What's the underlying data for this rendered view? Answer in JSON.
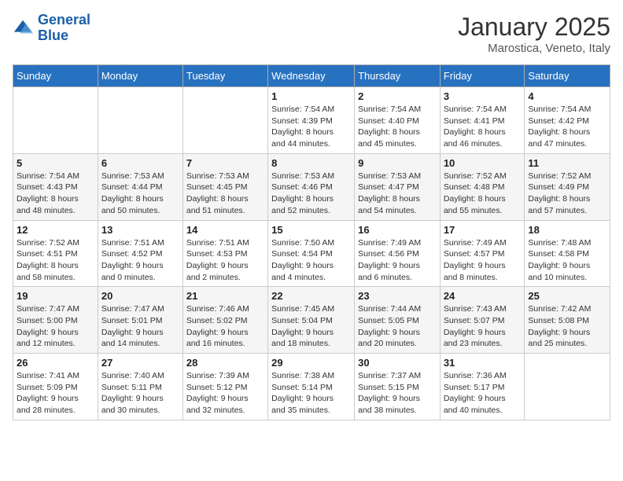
{
  "logo": {
    "line1": "General",
    "line2": "Blue"
  },
  "title": "January 2025",
  "subtitle": "Marostica, Veneto, Italy",
  "weekdays": [
    "Sunday",
    "Monday",
    "Tuesday",
    "Wednesday",
    "Thursday",
    "Friday",
    "Saturday"
  ],
  "weeks": [
    [
      {
        "day": "",
        "info": ""
      },
      {
        "day": "",
        "info": ""
      },
      {
        "day": "",
        "info": ""
      },
      {
        "day": "1",
        "info": "Sunrise: 7:54 AM\nSunset: 4:39 PM\nDaylight: 8 hours\nand 44 minutes."
      },
      {
        "day": "2",
        "info": "Sunrise: 7:54 AM\nSunset: 4:40 PM\nDaylight: 8 hours\nand 45 minutes."
      },
      {
        "day": "3",
        "info": "Sunrise: 7:54 AM\nSunset: 4:41 PM\nDaylight: 8 hours\nand 46 minutes."
      },
      {
        "day": "4",
        "info": "Sunrise: 7:54 AM\nSunset: 4:42 PM\nDaylight: 8 hours\nand 47 minutes."
      }
    ],
    [
      {
        "day": "5",
        "info": "Sunrise: 7:54 AM\nSunset: 4:43 PM\nDaylight: 8 hours\nand 48 minutes."
      },
      {
        "day": "6",
        "info": "Sunrise: 7:53 AM\nSunset: 4:44 PM\nDaylight: 8 hours\nand 50 minutes."
      },
      {
        "day": "7",
        "info": "Sunrise: 7:53 AM\nSunset: 4:45 PM\nDaylight: 8 hours\nand 51 minutes."
      },
      {
        "day": "8",
        "info": "Sunrise: 7:53 AM\nSunset: 4:46 PM\nDaylight: 8 hours\nand 52 minutes."
      },
      {
        "day": "9",
        "info": "Sunrise: 7:53 AM\nSunset: 4:47 PM\nDaylight: 8 hours\nand 54 minutes."
      },
      {
        "day": "10",
        "info": "Sunrise: 7:52 AM\nSunset: 4:48 PM\nDaylight: 8 hours\nand 55 minutes."
      },
      {
        "day": "11",
        "info": "Sunrise: 7:52 AM\nSunset: 4:49 PM\nDaylight: 8 hours\nand 57 minutes."
      }
    ],
    [
      {
        "day": "12",
        "info": "Sunrise: 7:52 AM\nSunset: 4:51 PM\nDaylight: 8 hours\nand 58 minutes."
      },
      {
        "day": "13",
        "info": "Sunrise: 7:51 AM\nSunset: 4:52 PM\nDaylight: 9 hours\nand 0 minutes."
      },
      {
        "day": "14",
        "info": "Sunrise: 7:51 AM\nSunset: 4:53 PM\nDaylight: 9 hours\nand 2 minutes."
      },
      {
        "day": "15",
        "info": "Sunrise: 7:50 AM\nSunset: 4:54 PM\nDaylight: 9 hours\nand 4 minutes."
      },
      {
        "day": "16",
        "info": "Sunrise: 7:49 AM\nSunset: 4:56 PM\nDaylight: 9 hours\nand 6 minutes."
      },
      {
        "day": "17",
        "info": "Sunrise: 7:49 AM\nSunset: 4:57 PM\nDaylight: 9 hours\nand 8 minutes."
      },
      {
        "day": "18",
        "info": "Sunrise: 7:48 AM\nSunset: 4:58 PM\nDaylight: 9 hours\nand 10 minutes."
      }
    ],
    [
      {
        "day": "19",
        "info": "Sunrise: 7:47 AM\nSunset: 5:00 PM\nDaylight: 9 hours\nand 12 minutes."
      },
      {
        "day": "20",
        "info": "Sunrise: 7:47 AM\nSunset: 5:01 PM\nDaylight: 9 hours\nand 14 minutes."
      },
      {
        "day": "21",
        "info": "Sunrise: 7:46 AM\nSunset: 5:02 PM\nDaylight: 9 hours\nand 16 minutes."
      },
      {
        "day": "22",
        "info": "Sunrise: 7:45 AM\nSunset: 5:04 PM\nDaylight: 9 hours\nand 18 minutes."
      },
      {
        "day": "23",
        "info": "Sunrise: 7:44 AM\nSunset: 5:05 PM\nDaylight: 9 hours\nand 20 minutes."
      },
      {
        "day": "24",
        "info": "Sunrise: 7:43 AM\nSunset: 5:07 PM\nDaylight: 9 hours\nand 23 minutes."
      },
      {
        "day": "25",
        "info": "Sunrise: 7:42 AM\nSunset: 5:08 PM\nDaylight: 9 hours\nand 25 minutes."
      }
    ],
    [
      {
        "day": "26",
        "info": "Sunrise: 7:41 AM\nSunset: 5:09 PM\nDaylight: 9 hours\nand 28 minutes."
      },
      {
        "day": "27",
        "info": "Sunrise: 7:40 AM\nSunset: 5:11 PM\nDaylight: 9 hours\nand 30 minutes."
      },
      {
        "day": "28",
        "info": "Sunrise: 7:39 AM\nSunset: 5:12 PM\nDaylight: 9 hours\nand 32 minutes."
      },
      {
        "day": "29",
        "info": "Sunrise: 7:38 AM\nSunset: 5:14 PM\nDaylight: 9 hours\nand 35 minutes."
      },
      {
        "day": "30",
        "info": "Sunrise: 7:37 AM\nSunset: 5:15 PM\nDaylight: 9 hours\nand 38 minutes."
      },
      {
        "day": "31",
        "info": "Sunrise: 7:36 AM\nSunset: 5:17 PM\nDaylight: 9 hours\nand 40 minutes."
      },
      {
        "day": "",
        "info": ""
      }
    ]
  ]
}
